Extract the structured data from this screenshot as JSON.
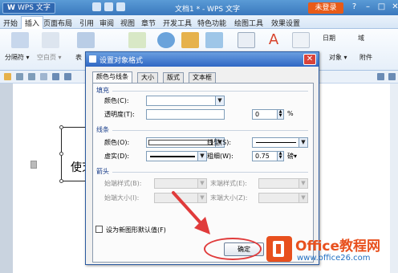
{
  "app": {
    "name": "WPS 文字",
    "logo": "W",
    "window_title": "文档1 * - WPS 文字",
    "login": "未登录"
  },
  "menu": [
    {
      "label": "开始"
    },
    {
      "label": "插入"
    },
    {
      "label": "页面布局"
    },
    {
      "label": "引用"
    },
    {
      "label": "审阅"
    },
    {
      "label": "视图"
    },
    {
      "label": "章节"
    },
    {
      "label": "开发工具"
    },
    {
      "label": "特色功能"
    },
    {
      "label": "绘图工具"
    },
    {
      "label": "效果设置"
    }
  ],
  "ribbon": {
    "page_break": "分隔符 ▾",
    "blank_page": "空白页 ▾",
    "table": "表",
    "date": "日期",
    "field": "域",
    "object": "对象 ▾",
    "attachment": "附件"
  },
  "document": {
    "shape_text": "使芝"
  },
  "dialog": {
    "title": "设置对象格式",
    "tabs": [
      {
        "label": "颜色与线条"
      },
      {
        "label": "大小"
      },
      {
        "label": "版式"
      },
      {
        "label": "文本框"
      }
    ],
    "fill": {
      "section": "填充",
      "color_label": "颜色(C):",
      "transparency_label": "透明度(T):",
      "transparency_value": "0",
      "percent": "%"
    },
    "line": {
      "section": "线条",
      "color_label": "颜色(O):",
      "style_label": "线型(S):",
      "dash_label": "虚实(D):",
      "weight_label": "粗细(W):",
      "weight_value": "0.75",
      "unit": "磅▾"
    },
    "arrows": {
      "section": "箭头",
      "begin_style": "始端样式(B):",
      "end_style": "末端样式(E):",
      "begin_size": "始端大小(I):",
      "end_size": "末端大小(Z):"
    },
    "default_checkbox": "设为新图形默认值(F)",
    "ok": "确定"
  },
  "watermark": {
    "brand": "Office教程网",
    "url": "www.office26.com"
  },
  "colors": {
    "accent": "#3a78bd",
    "highlight": "#e03b3b",
    "brand": "#e8501e"
  }
}
